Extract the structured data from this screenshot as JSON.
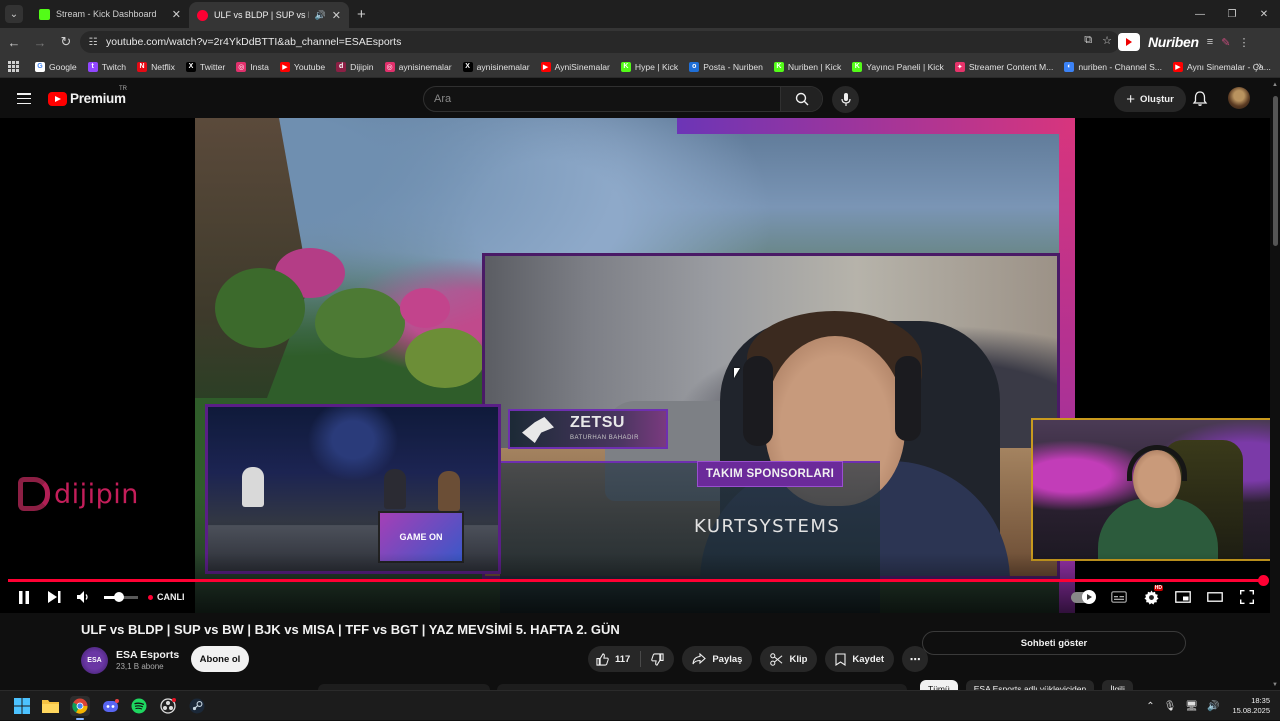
{
  "browser": {
    "tabs": [
      {
        "title": "Stream - Kick Dashboard",
        "favicon_color": "#53fc18",
        "active": false
      },
      {
        "title": "ULF vs BLDP | SUP vs BW | B",
        "favicon_color": "#ff0033",
        "active": true
      }
    ],
    "url": "youtube.com/watch?v=2r4YkDdBTTI&ab_channel=ESAEsports",
    "extension_label": "Nuriben",
    "bookmarks": [
      {
        "label": "Google",
        "icon_color": "#ffffff",
        "glyph": "G"
      },
      {
        "label": "Twitch",
        "icon_color": "#9146ff",
        "glyph": "t"
      },
      {
        "label": "Netflix",
        "icon_color": "#e50914",
        "glyph": "N"
      },
      {
        "label": "Twitter",
        "icon_color": "#000000",
        "glyph": "X"
      },
      {
        "label": "Insta",
        "icon_color": "#e1306c",
        "glyph": "◎"
      },
      {
        "label": "Youtube",
        "icon_color": "#ff0000",
        "glyph": "▶"
      },
      {
        "label": "Dijipin",
        "icon_color": "#8c1f44",
        "glyph": "d"
      },
      {
        "label": "aynisinemalar",
        "icon_color": "#e1306c",
        "glyph": "◎"
      },
      {
        "label": "aynisinemalar",
        "icon_color": "#000000",
        "glyph": "X"
      },
      {
        "label": "AyniSinemalar",
        "icon_color": "#ff0000",
        "glyph": "▶"
      },
      {
        "label": "Hype | Kick",
        "icon_color": "#53fc18",
        "glyph": "K"
      },
      {
        "label": "Posta - Nuriben",
        "icon_color": "#1f6fd8",
        "glyph": "o"
      },
      {
        "label": "Nuriben | Kick",
        "icon_color": "#53fc18",
        "glyph": "K"
      },
      {
        "label": "Yayıncı Paneli | Kick",
        "icon_color": "#53fc18",
        "glyph": "K"
      },
      {
        "label": "Streamer Content M...",
        "icon_color": "#e6336a",
        "glyph": "✦"
      },
      {
        "label": "nuriben - Channel S...",
        "icon_color": "#3b82f6",
        "glyph": "◐"
      },
      {
        "label": "Aynı Sinemalar - Ça...",
        "icon_color": "#ff0000",
        "glyph": "▶"
      }
    ]
  },
  "youtube": {
    "logo_text": "Premium",
    "country_code": "TR",
    "search_placeholder": "Ara",
    "create_label": "Oluştur"
  },
  "video": {
    "overlay_name": "ZETSU",
    "overlay_subtitle": "BATURHAN BAHADIR",
    "sponsor_title": "TAKIM SPONSORLARI",
    "sponsor_brand": "KURTSYSTEMS",
    "side_brand": "dijipin",
    "studio_screen": "GAME ON",
    "live_label": "CANLI",
    "volume_level": 0.45,
    "progress": 1.0
  },
  "meta": {
    "title": "ULF vs BLDP | SUP vs BW | BJK vs MISA | TFF vs BGT | YAZ MEVSİMİ 5. HAFTA 2. GÜN",
    "channel_name": "ESA Esports",
    "channel_avatar_text": "ESA",
    "subscribers": "23,1 B abone",
    "subscribe_label": "Abone ol",
    "likes": "117",
    "share_label": "Paylaş",
    "clip_label": "Klip",
    "save_label": "Kaydet",
    "show_chat_label": "Sohbeti göster",
    "chips": [
      "Tümü",
      "ESA Esports adlı yükleyiciden",
      "İlgili"
    ]
  },
  "taskbar": {
    "time": "18:35",
    "date": "15.08.2025"
  }
}
